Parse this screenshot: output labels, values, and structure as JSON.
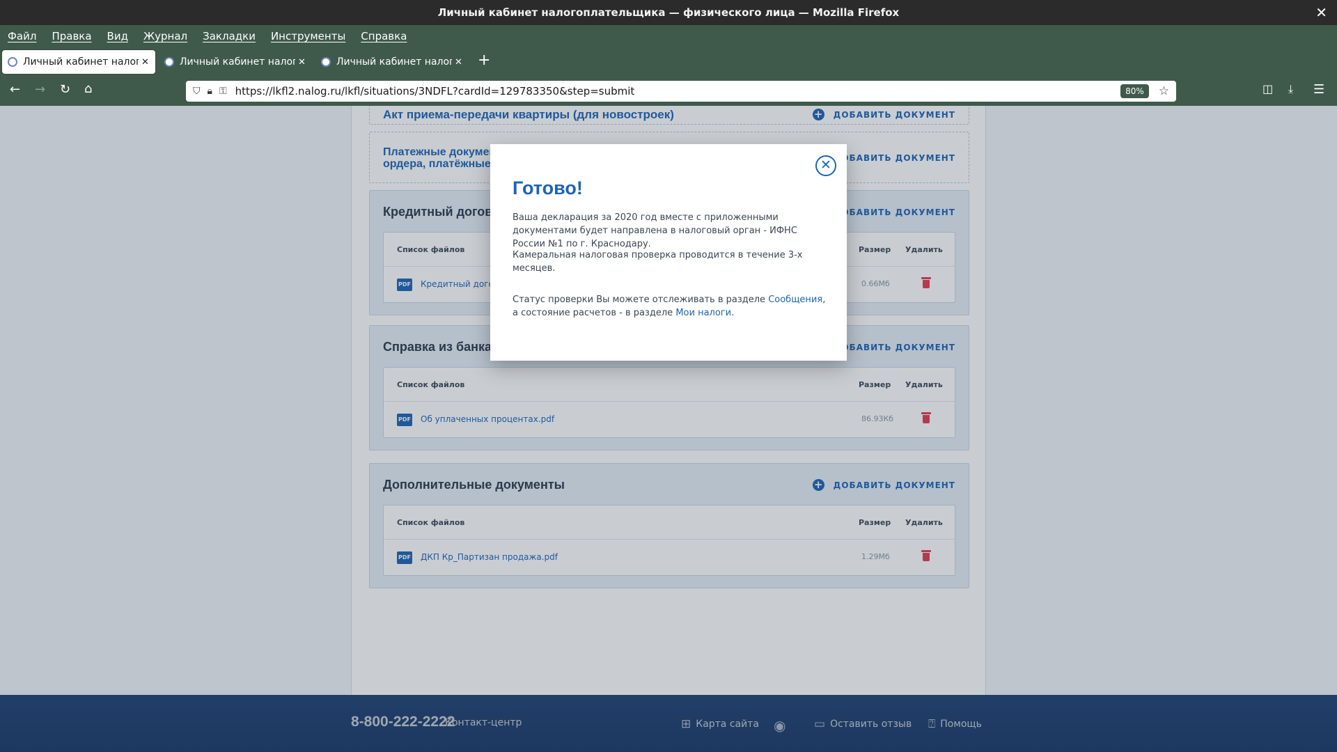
{
  "window": {
    "title": "Личный кабинет налогоплательщика — физического лица — Mozilla Firefox",
    "close": "✕"
  },
  "menu": [
    "Файл",
    "Правка",
    "Вид",
    "Журнал",
    "Закладки",
    "Инструменты",
    "Справка"
  ],
  "tabs": [
    {
      "label": "Личный кабинет налогоплательщика"
    },
    {
      "label": "Личный кабинет налогоплательщика"
    },
    {
      "label": "Личный кабинет налогоплательщика"
    }
  ],
  "toolbar": {
    "url": "https://lkfl2.nalog.ru/lkfl/situations/3NDFL?cardId=129783350&step=submit",
    "zoom": "80%"
  },
  "page": {
    "add_label": "ДОБАВИТЬ ДОКУМЕНТ",
    "files_header": "Список файлов",
    "size_header": "Размер",
    "delete_header": "Удалить",
    "doc_act": "Акт приема-передачи квартиры (для новостроек)",
    "doc_payment_line1": "Платежные документы (чеки,",
    "doc_payment_line2": "ордера, платёжные поручения)",
    "credit": {
      "title": "Кредитный договор",
      "file": "Кредитный договор.pdf",
      "size": "0.66Мб"
    },
    "bank": {
      "title": "Справка из банка об уплаченных процентах",
      "file": "Об уплаченных процентах.pdf",
      "size": "86.93Кб"
    },
    "extra": {
      "title": "Дополнительные документы",
      "file": "ДКП Кр_Партизан продажа.pdf",
      "size": "1.29Мб"
    }
  },
  "modal": {
    "title": "Готово!",
    "p1": "Ваша декларация за 2020 год вместе с приложенными документами будет направлена в налоговый орган - ИФНС России №1 по г. Краснодару.",
    "p2": "Камеральная налоговая проверка проводится в течение 3-х месяцев.",
    "p3_before": "Статус проверки Вы можете отслеживать в разделе ",
    "p3_link1": "Сообщения",
    "p3_middle": ", а состояние расчетов - в разделе ",
    "p3_link2": "Мои налоги",
    "p3_end": "."
  },
  "footer": {
    "phone": "8-800-222-2222",
    "contact": "Контакт-центр",
    "sitemap": "Карта сайта",
    "feedback": "Оставить отзыв",
    "help": "Помощь"
  }
}
